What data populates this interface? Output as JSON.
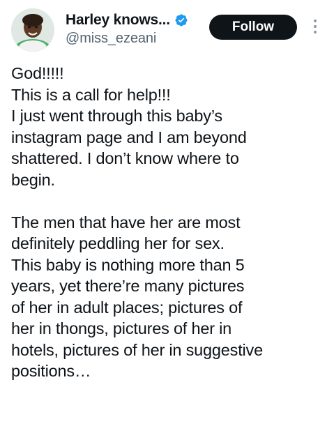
{
  "header": {
    "display_name": "Harley knows...",
    "handle": "@miss_ezeani",
    "follow_label": "Follow"
  },
  "icons": {
    "verified": "verified-badge-icon",
    "more": "more-options-icon",
    "avatar": "profile-avatar"
  },
  "colors": {
    "verified_blue": "#1d9bf0",
    "follow_bg": "#0f1419",
    "handle_gray": "#536471",
    "text": "#0f1419"
  },
  "tweet": {
    "paragraph1": [
      "God!!!!!",
      "This is a call for help!!!",
      "I just went through this baby’s",
      "instagram page and I am beyond",
      "shattered. I don’t know where to",
      "begin."
    ],
    "paragraph2": [
      "The men that have her are most",
      "definitely peddling her for sex.",
      "This baby is nothing more than 5",
      "years, yet there’re many pictures",
      "of her in adult places; pictures of",
      "her in thongs, pictures of her in",
      "hotels, pictures of her in suggestive",
      "positions…"
    ]
  }
}
